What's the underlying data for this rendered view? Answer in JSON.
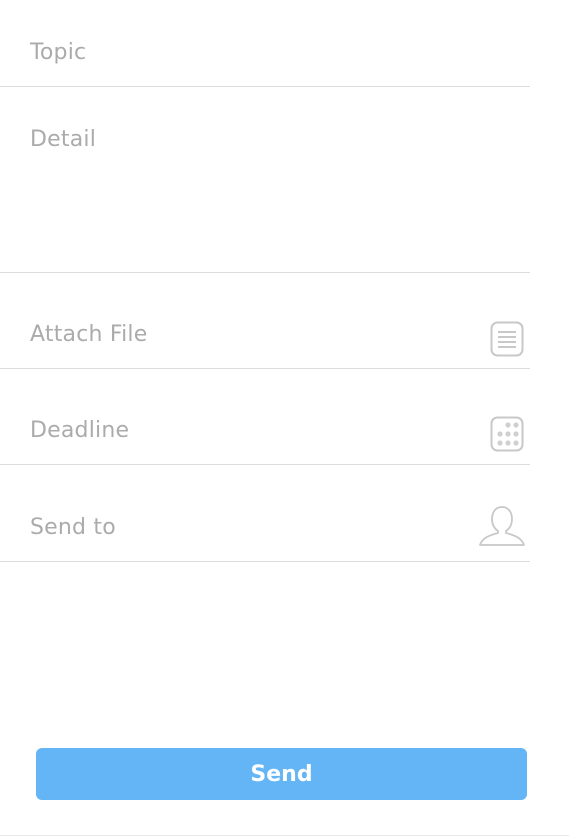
{
  "form": {
    "topic_placeholder": "Topic",
    "detail_placeholder": "Detail",
    "attach_label": "Attach File",
    "deadline_label": "Deadline",
    "send_to_label": "Send to"
  },
  "icons": {
    "attach": "document-icon",
    "deadline": "calendar-grid-icon",
    "send_to": "person-icon"
  },
  "actions": {
    "send_label": "Send"
  },
  "colors": {
    "accent": "#64b5f6",
    "placeholder": "#ababab",
    "divider": "#dcdcdc"
  }
}
